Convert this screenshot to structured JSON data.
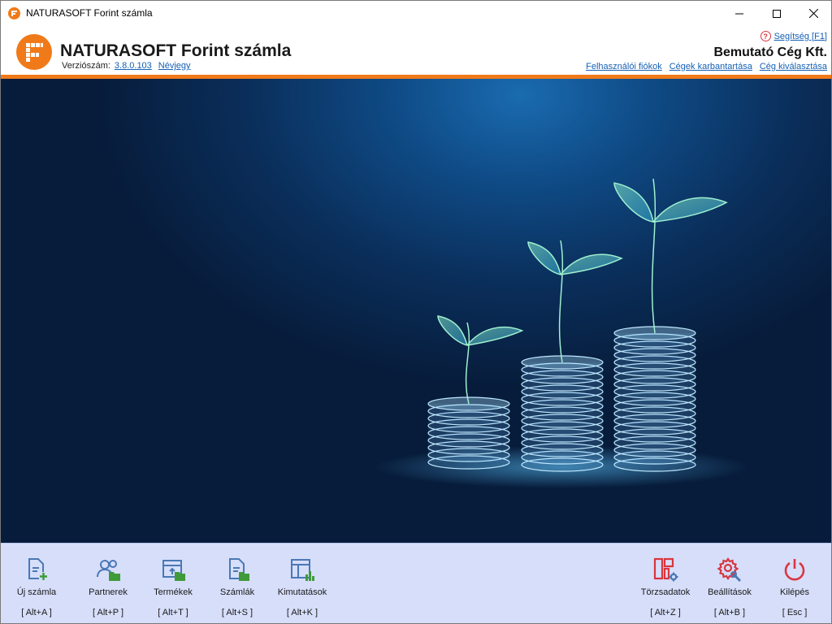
{
  "window": {
    "title": "NATURASOFT Forint számla"
  },
  "header": {
    "app_name": "NATURASOFT Forint számla",
    "version_label": "Verziószám:",
    "version_value": "3.8.0.103",
    "about_link": "Névjegy",
    "help_link": "Segítség [F1]",
    "company_name": "Bemutató Cég Kft.",
    "links": [
      "Felhasználói fiókok",
      "Cégek karbantartása",
      "Cég kiválasztása"
    ]
  },
  "toolbar": {
    "left": [
      {
        "label": "Új számla",
        "key": "[ Alt+A ]",
        "icon": "new-invoice-icon"
      },
      {
        "label": "Partnerek",
        "key": "[ Alt+P ]",
        "icon": "partners-icon"
      },
      {
        "label": "Termékek",
        "key": "[ Alt+T ]",
        "icon": "products-icon"
      },
      {
        "label": "Számlák",
        "key": "[ Alt+S ]",
        "icon": "invoices-icon"
      },
      {
        "label": "Kimutatások",
        "key": "[ Alt+K ]",
        "icon": "reports-icon"
      }
    ],
    "right": [
      {
        "label": "Törzsadatok",
        "key": "[ Alt+Z ]",
        "icon": "master-data-icon"
      },
      {
        "label": "Beállítások",
        "key": "[ Alt+B ]",
        "icon": "settings-icon"
      },
      {
        "label": "Kilépés",
        "key": "[ Esc ]",
        "icon": "power-icon"
      }
    ]
  },
  "colors": {
    "accent": "#f07a1a",
    "link": "#1560b5",
    "toolbar_bg": "#d6defa",
    "icon_blue": "#4a78b5",
    "icon_green": "#3f9a3a",
    "icon_red": "#d9363e"
  }
}
